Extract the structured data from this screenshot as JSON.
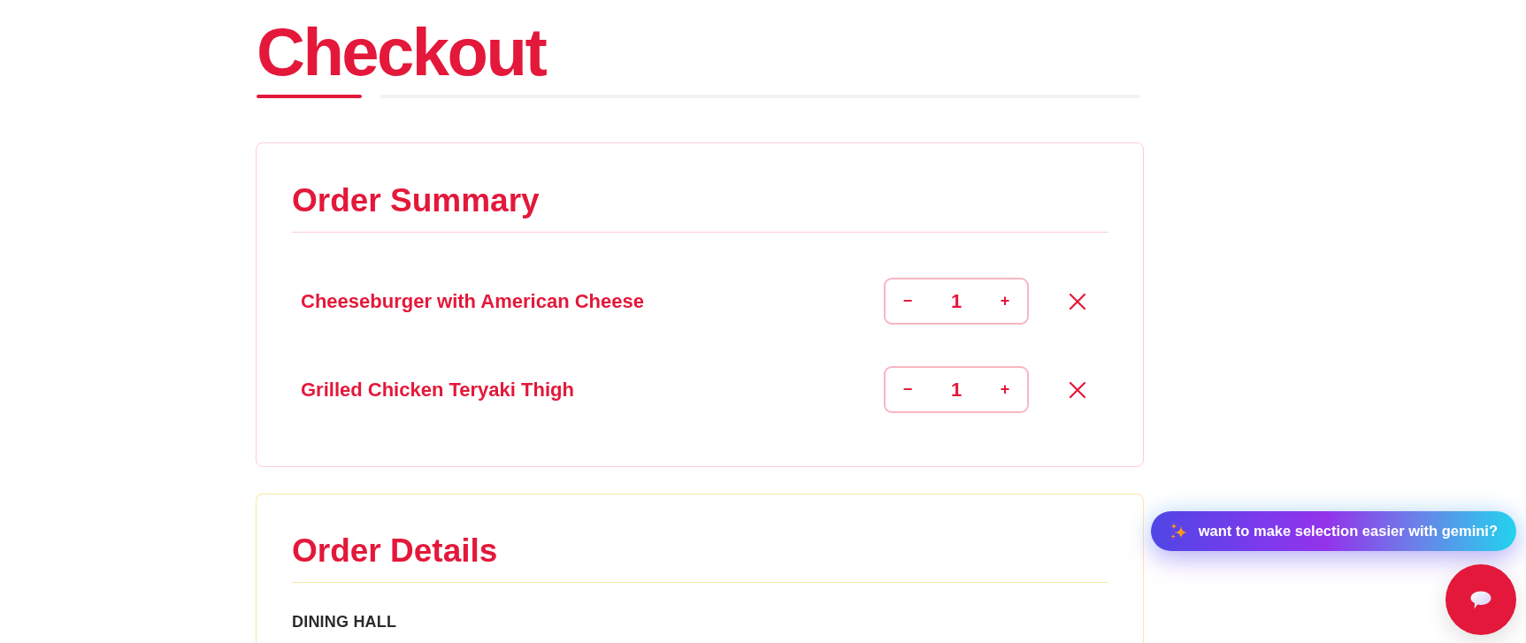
{
  "title": "Checkout",
  "order_summary": {
    "heading": "Order Summary",
    "items": [
      {
        "name": "Cheeseburger with American Cheese",
        "decrement": "−",
        "quantity": "1",
        "increment": "+"
      },
      {
        "name": "Grilled Chicken Teryaki Thigh",
        "decrement": "−",
        "quantity": "1",
        "increment": "+"
      }
    ]
  },
  "order_details": {
    "heading": "Order Details",
    "fields": [
      {
        "label": "DINING HALL"
      }
    ]
  },
  "assistant_prompt": {
    "label": "want to make selection easier with gemini?"
  }
}
